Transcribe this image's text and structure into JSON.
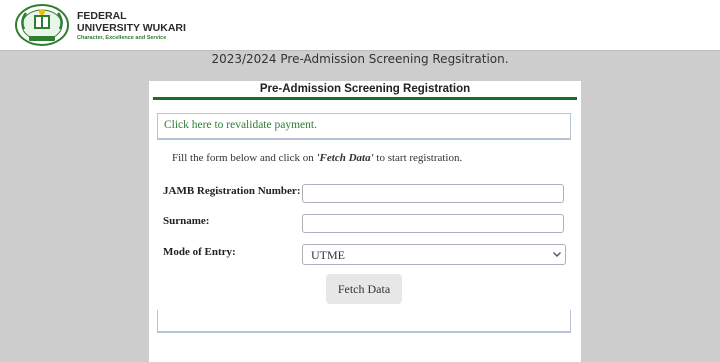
{
  "header": {
    "university_name": "FEDERAL UNIVERSITY WUKARI",
    "motto": "Character, Excellence and Service",
    "logo_icon": "university-crest-icon"
  },
  "page": {
    "heading": "2023/2024 Pre-Admission Screening Regsitration."
  },
  "panel": {
    "title": "Pre-Admission Screening Registration",
    "revalidate_link": "Click here to revalidate payment.",
    "instruction_prefix": "Fill the form below and click on ",
    "instruction_emphasis": "'Fetch Data'",
    "instruction_suffix": " to start registration.",
    "accent_color": "#1b6e2a"
  },
  "form": {
    "jamb_label": "JAMB Registration Number:",
    "jamb_value": "",
    "surname_label": "Surname:",
    "surname_value": "",
    "mode_label": "Mode of Entry:",
    "mode_value": "UTME",
    "mode_icon": "chevron-down-icon",
    "fetch_button": "Fetch Data"
  }
}
